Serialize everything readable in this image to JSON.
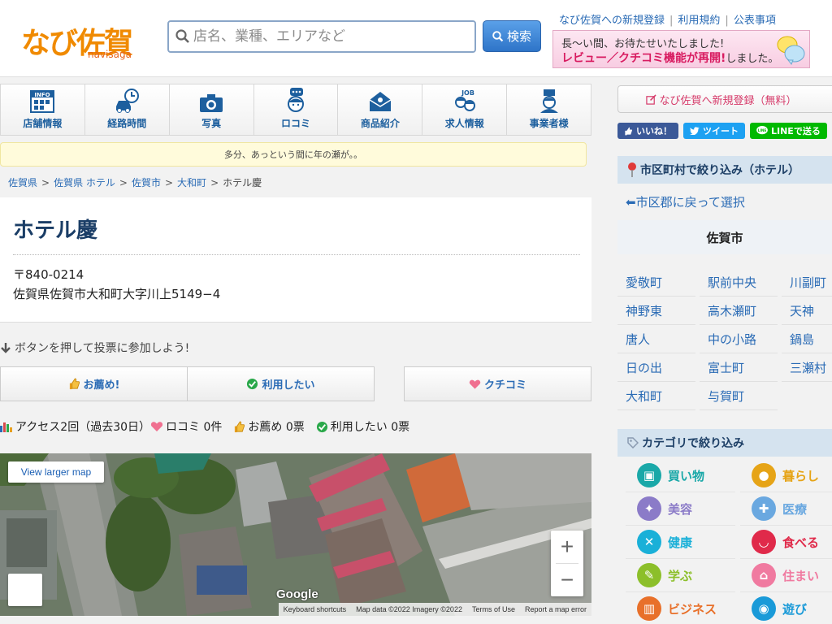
{
  "header": {
    "logo_text": "なび佐賀",
    "logo_sub": "navisaga",
    "search_placeholder": "店名、業種、エリアなど",
    "search_button": "検索",
    "top_links": [
      "なび佐賀への新規登録",
      "利用規約",
      "公表事項"
    ],
    "banner_line1": "長〜い間、お待たせいたしました!",
    "banner_line2": "レビュー／クチコミ機能が再開!",
    "banner_line2_tail": "しました。"
  },
  "nav_tabs": [
    {
      "label": "店舗情報",
      "icon": "info-icon"
    },
    {
      "label": "経路時間",
      "icon": "car-clock-icon"
    },
    {
      "label": "写真",
      "icon": "camera-icon"
    },
    {
      "label": "ロコミ",
      "icon": "chat-person-icon"
    },
    {
      "label": "商品紹介",
      "icon": "gift-icon"
    },
    {
      "label": "求人情報",
      "icon": "job-icon"
    },
    {
      "label": "事業者様",
      "icon": "business-person-icon"
    }
  ],
  "notice": "多分、あっという間に年の瀬が。。",
  "breadcrumb": [
    "佐賀県",
    "佐賀県 ホテル",
    "佐賀市",
    "大和町"
  ],
  "breadcrumb_current": "ホテル慶",
  "shop": {
    "name": "ホテル慶",
    "postal": "〒840-0214",
    "address": "佐賀県佐賀市大和町大字川上5149−4"
  },
  "vote": {
    "prompt": "ボタンを押して投票に参加しよう!",
    "recommend_label": "お薦め!",
    "want_label": "利用したい",
    "review_label": "クチコミ"
  },
  "stats": {
    "access": "アクセス2回（過去30日）",
    "kuchikomi": "ロコミ 0件",
    "osusume": "お薦め 0票",
    "riyou": "利用したい 0票"
  },
  "map": {
    "view_larger": "View larger map",
    "google": "Google",
    "footer": [
      "Keyboard shortcuts",
      "Map data ©2022 Imagery ©2022",
      "Terms of Use",
      "Report a map error"
    ]
  },
  "sidebar": {
    "register": "なび佐賀へ新規登録（無料）",
    "share": {
      "like": "いいね！",
      "tweet": "ツイート",
      "line": "LINEで送る"
    },
    "area_head": "市区町村で絞り込み（ホテル）",
    "back_link": "⬅市区郡に戻って選択",
    "city": "佐賀市",
    "towns": [
      "愛敬町",
      "駅前中央",
      "川副町",
      "神野東",
      "高木瀬町",
      "天神",
      "唐人",
      "中の小路",
      "鍋島",
      "日の出",
      "富士町",
      "三瀬村",
      "大和町",
      "与賀町"
    ],
    "category_head": "カテゴリで絞り込み",
    "categories": [
      {
        "label": "買い物",
        "color": "#1aa8a8"
      },
      {
        "label": "暮らし",
        "color": "#e6a417"
      },
      {
        "label": "美容",
        "color": "#8b7bc8"
      },
      {
        "label": "医療",
        "color": "#6aa8e0"
      },
      {
        "label": "健康",
        "color": "#1ab0d8"
      },
      {
        "label": "食べる",
        "color": "#e02a4a"
      },
      {
        "label": "学ぶ",
        "color": "#8cbf2a"
      },
      {
        "label": "住まい",
        "color": "#f07aa0"
      },
      {
        "label": "ビジネス",
        "color": "#e8702a"
      },
      {
        "label": "遊び",
        "color": "#1a9ad8"
      }
    ]
  }
}
